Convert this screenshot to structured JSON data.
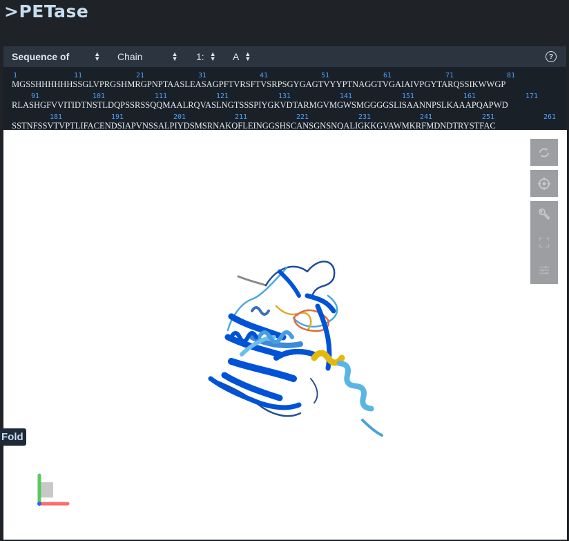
{
  "title": ">PETase",
  "controls": {
    "sequence_of": "Sequence of",
    "chain_label": "Chain",
    "model": "1:",
    "chain_id": "A",
    "help": "?"
  },
  "sequence": [
    {
      "residues": "MGSSHHHHHHSSGLVPRGSHMRGPNPTAASLEASAGPFTVRSFTVSRPSGYGAGTVYYPTNAGGTVGAIAIVPGYTARQSSIKWWGP",
      "numbers": [
        "1",
        "11",
        "21",
        "31",
        "41",
        "51",
        "61",
        "71",
        "81"
      ]
    },
    {
      "residues": "RLASHGFVVITIDTNSTLDQPSSRSSQQMAALRQVASLNGTSSSPIYGKVDTARMGVMGWSMGGGGSLISAANNPSLKAAAPQAPWD",
      "numbers": [
        "91",
        "101",
        "111",
        "121",
        "131",
        "141",
        "151",
        "161",
        "171"
      ]
    },
    {
      "residues": "SSTNFSSVTVPTLIFACENDSIAPVNSSALPIYDSMSRNAKQFLEINGGSHSCANSGNSNQALIGKKGVAWMKRFMDNDTRYSTFAC",
      "numbers": [
        "181",
        "191",
        "201",
        "211",
        "221",
        "231",
        "241",
        "251",
        "261"
      ]
    }
  ],
  "viewer": {
    "tools": [
      {
        "name": "rotate-icon"
      },
      {
        "name": "camera-center-icon"
      },
      {
        "name": "wrench-icon"
      },
      {
        "name": "expand-icon"
      },
      {
        "name": "sliders-icon"
      }
    ],
    "fold_label": "Fold"
  },
  "colors": {
    "very_high": "#0053d6",
    "confident": "#65cbf3",
    "low": "#ffdb13",
    "very_low": "#ff7d45"
  }
}
